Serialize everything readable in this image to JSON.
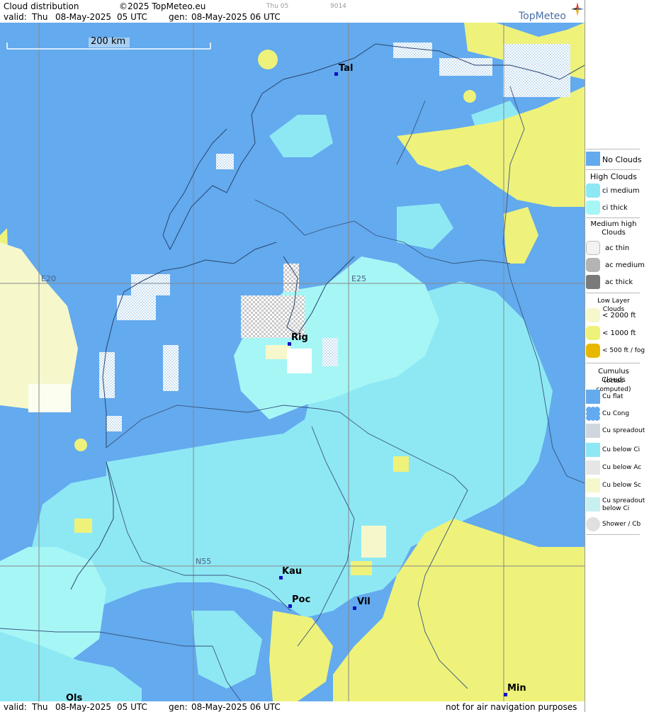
{
  "header": {
    "title": "Cloud distribution",
    "copyright": "©2025 TopMeteo.eu",
    "timestamp_small": "Thu 05",
    "code_small": "9014",
    "valid_label": "valid:",
    "valid_day": "Thu",
    "valid_date": "08-May-2025",
    "valid_time": "05 UTC",
    "gen_label": "gen:",
    "gen_value": "08-May-2025 06 UTC",
    "logo": "TopMeteo"
  },
  "footer": {
    "valid_label": "valid:",
    "valid_day": "Thu",
    "valid_date": "08-May-2025",
    "valid_time": "05 UTC",
    "gen_label": "gen:",
    "gen_value": "08-May-2025 06 UTC",
    "disclaimer": "not for air navigation purposes"
  },
  "map": {
    "scale_label": "200 km",
    "gridlines": [
      "E20",
      "E25",
      "N55"
    ],
    "cities": [
      {
        "code": "Tal"
      },
      {
        "code": "Rig"
      },
      {
        "code": "Kau"
      },
      {
        "code": "Poc"
      },
      {
        "code": "Vil"
      },
      {
        "code": "Min"
      },
      {
        "code": "Ols"
      }
    ],
    "colors": {
      "no_clouds": "#63aaee",
      "ci_medium": "#8ee8f4",
      "ci_thick": "#a6f6f6",
      "low_2000": "#f6f8cc",
      "low_1000": "#eef27a",
      "low_500": "#e8b800"
    }
  },
  "legend": {
    "no_clouds": "No Clouds",
    "high_clouds_title": "High Clouds",
    "ci_medium": "ci medium",
    "ci_thick": "ci thick",
    "medium_title_1": "Medium high",
    "medium_title_2": "Clouds",
    "ac_thin": "ac thin",
    "ac_medium": "ac medium",
    "ac_thick": "ac thick",
    "low_title": "Low Layer Clouds",
    "low_2000": "< 2000 ft",
    "low_1000": "< 1000 ft",
    "low_500": "< 500 ft / fog",
    "cu_title": "Cumulus Clouds",
    "cu_subtitle": "(octas computed)",
    "cu_flat": "Cu flat",
    "cu_cong": "Cu Cong",
    "cu_spreadout": "Cu spreadout",
    "cu_below_ci": "Cu below Ci",
    "cu_below_ac": "Cu below Ac",
    "cu_below_sc": "Cu below Sc",
    "cu_spreadout_below_ci_1": "Cu spreadout",
    "cu_spreadout_below_ci_2": "below Ci",
    "shower_cb": "Shower / Cb"
  }
}
